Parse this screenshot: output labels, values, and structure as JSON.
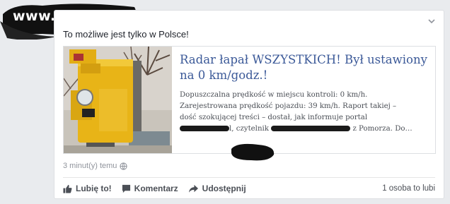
{
  "watermark": {
    "text": "www.wiocha.pl"
  },
  "post": {
    "message": "To możliwe jest tylko w Polsce!",
    "menu_icon": "chevron-down-icon",
    "link": {
      "title": "Radar łapał WSZYSTKICH! Był ustawiony na 0 km/godz.!",
      "desc_line1": "Dopuszczalna prędkość w miejscu kontroli: 0 km/h.",
      "desc_line2": "Zarejestrowana prędkość pojazdu: 39 km/h. Raport takiej –",
      "desc_line3": "dość szokującej treści – dostał, jak informuje portal",
      "desc_line4a": "l, czytelnik",
      "desc_line4b": "z Pomorza. Do…",
      "image": "speed-camera-photo"
    },
    "timestamp": "3 minut(y) temu",
    "privacy_icon": "globe-icon"
  },
  "actions": {
    "like_label": "Lubię to!",
    "comment_label": "Komentarz",
    "share_label": "Udostępnij",
    "likes_count": "1 osoba to lubi"
  },
  "colors": {
    "link_title": "#3b5998",
    "background": "#e9ebee",
    "camera_yellow": "#e8b417"
  }
}
